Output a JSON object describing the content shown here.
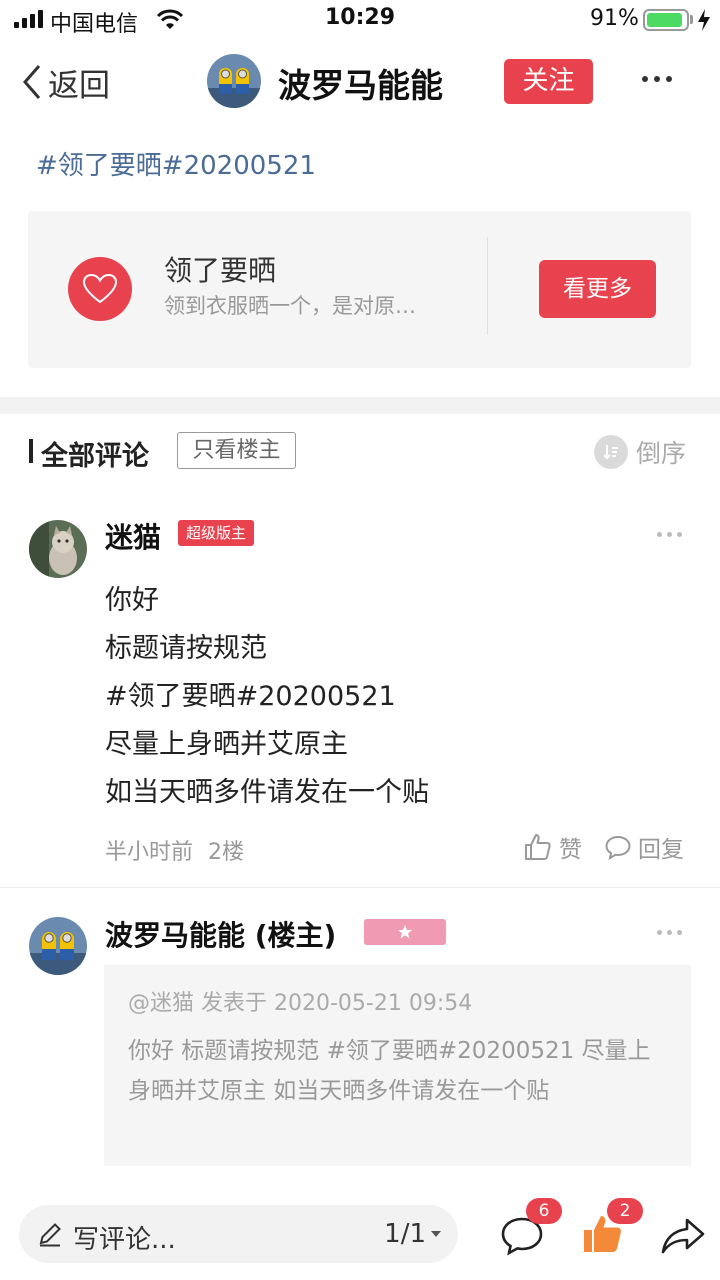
{
  "status_bar": {
    "carrier": "中国电信",
    "time": "10:29",
    "battery_percent": "91%",
    "battery_level": 0.91
  },
  "nav": {
    "back_label": "返回",
    "title": "波罗马能能",
    "follow_label": "关注"
  },
  "topic": "#领了要晒#20200521",
  "card": {
    "title": "领了要晒",
    "description": "领到衣服晒一个，是对原…",
    "button_label": "看更多"
  },
  "comments_header": {
    "title": "全部评论",
    "filter_label": "只看楼主",
    "sort_label": "倒序"
  },
  "comments": [
    {
      "name": "迷猫",
      "badge": "超级版主",
      "lines": [
        "你好",
        "标题请按规范",
        "#领了要晒#20200521",
        "尽量上身晒并艾原主",
        "如当天晒多件请发在一个贴"
      ],
      "time": "半小时前",
      "floor": "2楼",
      "like_label": "赞",
      "reply_label": "回复"
    },
    {
      "name": "波罗马能能 (楼主)",
      "badge_icon": "star-icon",
      "quote_header": "@迷猫 发表于 2020-05-21 09:54",
      "quote_body": "你好 标题请按规范 #领了要晒#20200521 尽量上身晒并艾原主 如当天晒多件请发在一个贴"
    }
  ],
  "bottom_bar": {
    "write_placeholder": "写评论...",
    "page": "1/1",
    "comment_count": "6",
    "like_count": "2"
  },
  "colors": {
    "accent": "#e8424f",
    "topic_link": "#4a6c96",
    "like_orange": "#f5893a",
    "badge_pink": "#f09ab4"
  }
}
